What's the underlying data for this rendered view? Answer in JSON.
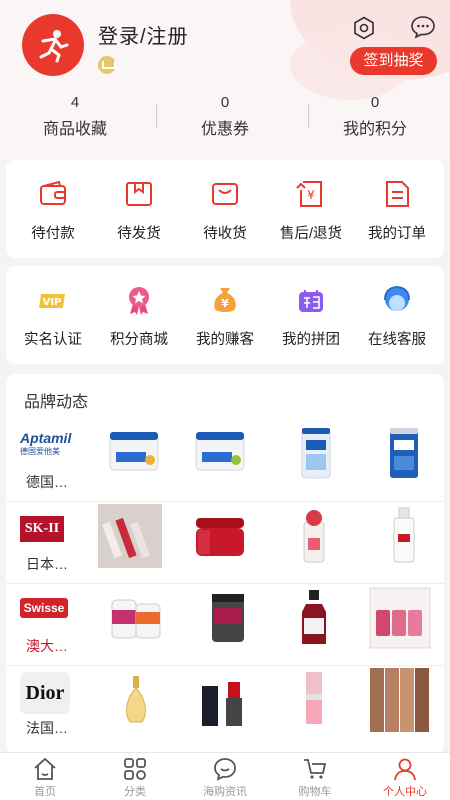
{
  "header": {
    "username": "登录/注册",
    "signin_label": "签到抽奖"
  },
  "stats": [
    {
      "value": "4",
      "label": "商品收藏"
    },
    {
      "value": "0",
      "label": "优惠券"
    },
    {
      "value": "0",
      "label": "我的积分"
    }
  ],
  "orders": [
    {
      "label": "待付款",
      "icon": "wallet-icon"
    },
    {
      "label": "待发货",
      "icon": "package-icon"
    },
    {
      "label": "待收货",
      "icon": "inbox-icon"
    },
    {
      "label": "售后/退货",
      "icon": "refund-icon"
    },
    {
      "label": "我的订单",
      "icon": "order-list-icon"
    }
  ],
  "services": [
    {
      "label": "实名认证",
      "icon": "vip-icon"
    },
    {
      "label": "积分商城",
      "icon": "medal-icon"
    },
    {
      "label": "我的赚客",
      "icon": "money-bag-icon"
    },
    {
      "label": "我的拼团",
      "icon": "group-buy-icon"
    },
    {
      "label": "在线客服",
      "icon": "customer-service-icon"
    }
  ],
  "brands": {
    "title": "品牌动态",
    "rows": [
      {
        "name": "德国…",
        "logo": "Aptamil",
        "logo_sub": "德国爱他美"
      },
      {
        "name": "日本…",
        "logo": "SK-II"
      },
      {
        "name": "澳大…",
        "logo": "Swisse"
      },
      {
        "name": "法国…",
        "logo": "Dior"
      }
    ]
  },
  "tabbar": [
    {
      "label": "首页",
      "icon": "home-icon"
    },
    {
      "label": "分类",
      "icon": "category-icon"
    },
    {
      "label": "海购资讯",
      "icon": "chat-icon"
    },
    {
      "label": "购物车",
      "icon": "cart-icon"
    },
    {
      "label": "个人中心",
      "icon": "person-icon"
    }
  ],
  "colors": {
    "accent": "#e8392c",
    "inactive": "#999999"
  }
}
